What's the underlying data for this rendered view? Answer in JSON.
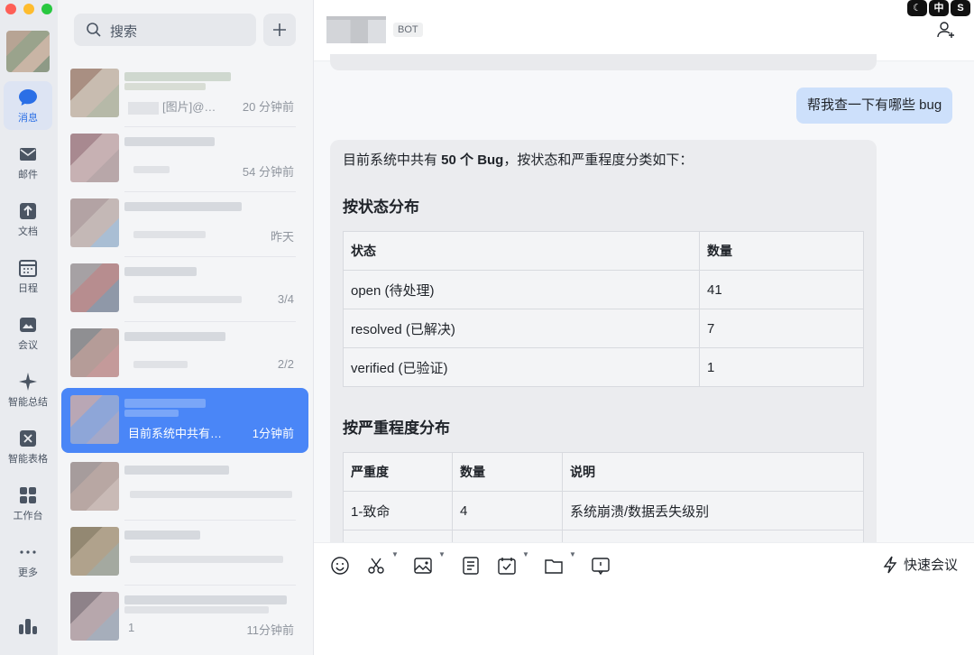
{
  "sidebar": {
    "items": [
      {
        "label": "消息",
        "icon": "chat-bubble-icon",
        "active": true
      },
      {
        "label": "邮件",
        "icon": "mail-icon"
      },
      {
        "label": "文档",
        "icon": "docs-icon"
      },
      {
        "label": "日程",
        "icon": "calendar-icon"
      },
      {
        "label": "会议",
        "icon": "meeting-icon"
      },
      {
        "label": "智能总结",
        "icon": "sparkle-icon"
      },
      {
        "label": "智能表格",
        "icon": "smart-table-icon"
      },
      {
        "label": "工作台",
        "icon": "workbench-grid-icon"
      },
      {
        "label": "更多",
        "icon": "more-dots-icon"
      }
    ]
  },
  "search": {
    "placeholder": "搜索"
  },
  "conversations": [
    {
      "preview": "[图片]@…",
      "time": "20 分钟前"
    },
    {
      "preview": "",
      "time": "54 分钟前"
    },
    {
      "preview": "",
      "time": "昨天"
    },
    {
      "preview": "",
      "time": "3/4"
    },
    {
      "preview": "",
      "time": "2/2"
    },
    {
      "preview": "目前系统中共有…",
      "time": "1分钟前",
      "active": true
    },
    {
      "preview": "",
      "time": ""
    },
    {
      "preview": "",
      "time": ""
    },
    {
      "preview": "1",
      "time": "11分钟前"
    }
  ],
  "chat": {
    "bot_tag": "BOT",
    "user_message": "帮我查一下有哪些 bug",
    "bot_reply": {
      "intro_before": "目前系统中共有 ",
      "intro_bold": "50 个 Bug",
      "intro_after": "，按状态和严重程度分类如下：",
      "section1_title": "按状态分布",
      "status_table": {
        "headers": [
          "状态",
          "数量"
        ],
        "rows": [
          [
            "open (待处理)",
            "41"
          ],
          [
            "resolved (已解决)",
            "7"
          ],
          [
            "verified (已验证)",
            "1"
          ]
        ]
      },
      "section2_title": "按严重程度分布",
      "severity_table": {
        "headers": [
          "严重度",
          "数量",
          "说明"
        ],
        "rows": [
          [
            "1-致命",
            "4",
            "系统崩溃/数据丢失级别"
          ]
        ]
      }
    }
  },
  "composer": {
    "quick_meeting_label": "快速会议"
  },
  "corner_badges": [
    "☾",
    "中",
    "S"
  ],
  "colors": {
    "accent": "#4a86f7",
    "user_bubble": "#cde0fb",
    "bot_bubble": "#ebecef"
  }
}
